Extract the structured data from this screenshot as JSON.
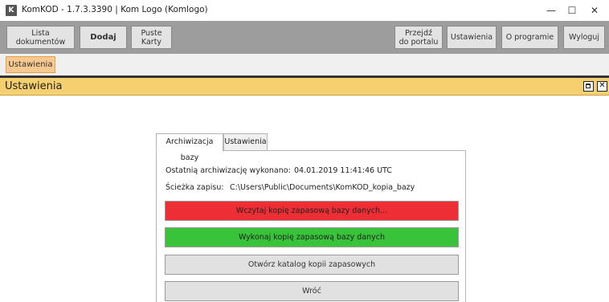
{
  "window": {
    "app_icon_letter": "K",
    "title": "KomKOD - 1.7.3.3390 | Kom Logo (Komlogo)",
    "minimize_glyph": "—",
    "maximize_glyph": "☐",
    "close_glyph": "✕"
  },
  "toolbar": {
    "documents_label": "Lista\ndokumentów",
    "add_label": "Dodaj",
    "blank_cards_label": "Puste\nKarty",
    "portal_label": "Przejdź\ndo portalu",
    "settings_label": "Ustawienia",
    "about_label": "O programie",
    "logout_label": "Wyloguj"
  },
  "page_tabs": {
    "active_label": "Ustawienia"
  },
  "section": {
    "title": "Ustawienia",
    "close_glyph": "✕"
  },
  "dialog": {
    "tabs": [
      "Archiwizacja bazy",
      "Ustawienia"
    ],
    "last_backup_label": "Ostatnią archiwizację wykonano:",
    "last_backup_value": "04.01.2019 11:41:46 UTC",
    "path_label": "Ścieżka zapisu:",
    "path_value": "C:\\Users\\Public\\Documents\\KomKOD_kopia_bazy",
    "restore_button": "Wczytaj kopię zapasową bazy danych...",
    "backup_button": "Wykonaj kopię zapasową bazy danych",
    "open_folder_button": "Otwórz katalog kopii zapasowych",
    "back_button": "Wróć"
  },
  "colors": {
    "toolbar_bg": "#9d9d9d",
    "section_header_bg": "#f6cf6f",
    "active_page_tab": "#f8c98e",
    "restore_button": "#ed2e35",
    "backup_button": "#38c33a"
  }
}
